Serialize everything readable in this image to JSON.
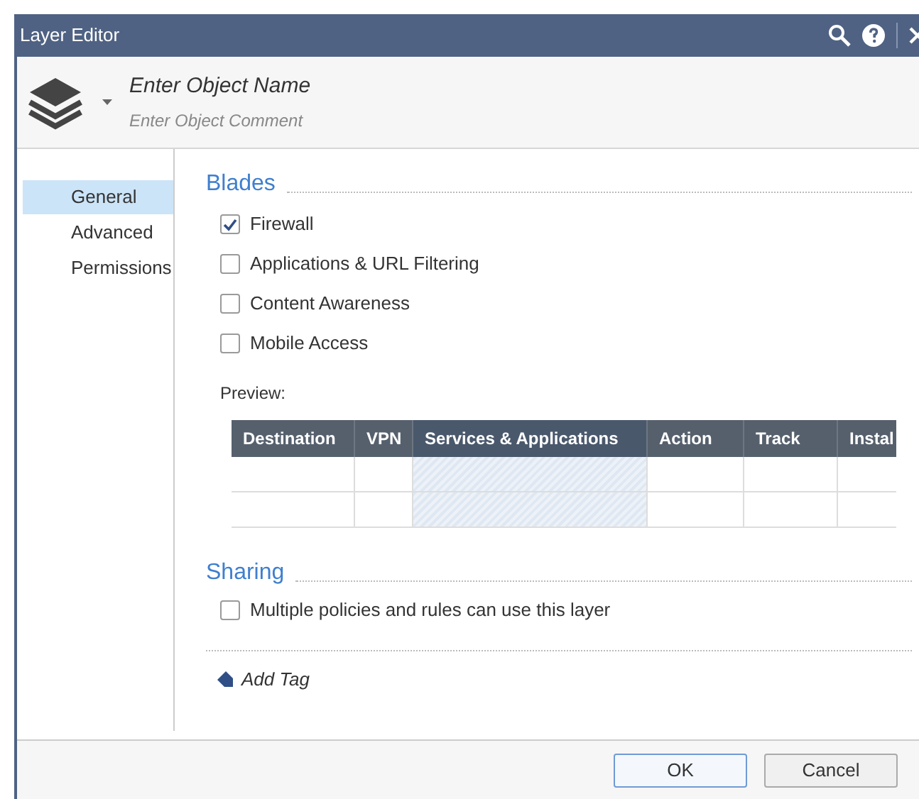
{
  "window": {
    "title": "Layer Editor"
  },
  "header": {
    "name_placeholder": "Enter Object Name",
    "comment_placeholder": "Enter Object Comment"
  },
  "sidebar": {
    "items": [
      {
        "label": "General",
        "selected": true
      },
      {
        "label": "Advanced",
        "selected": false
      },
      {
        "label": "Permissions",
        "selected": false
      }
    ]
  },
  "blades": {
    "title": "Blades",
    "options": [
      {
        "label": "Firewall",
        "checked": true
      },
      {
        "label": "Applications & URL Filtering",
        "checked": false
      },
      {
        "label": "Content Awareness",
        "checked": false
      },
      {
        "label": "Mobile Access",
        "checked": false
      }
    ]
  },
  "preview": {
    "label": "Preview:",
    "columns": [
      {
        "label": "Destination",
        "highlighted": false
      },
      {
        "label": "VPN",
        "highlighted": false
      },
      {
        "label": "Services & Applications",
        "highlighted": true
      },
      {
        "label": "Action",
        "highlighted": false
      },
      {
        "label": "Track",
        "highlighted": false
      },
      {
        "label": "Instal",
        "highlighted": false
      }
    ]
  },
  "sharing": {
    "title": "Sharing",
    "options": [
      {
        "label": "Multiple policies and rules can use this layer",
        "checked": false
      }
    ]
  },
  "add_tag": "Add Tag",
  "buttons": [
    {
      "label": "OK",
      "default": true
    },
    {
      "label": "Cancel",
      "default": false
    }
  ]
}
